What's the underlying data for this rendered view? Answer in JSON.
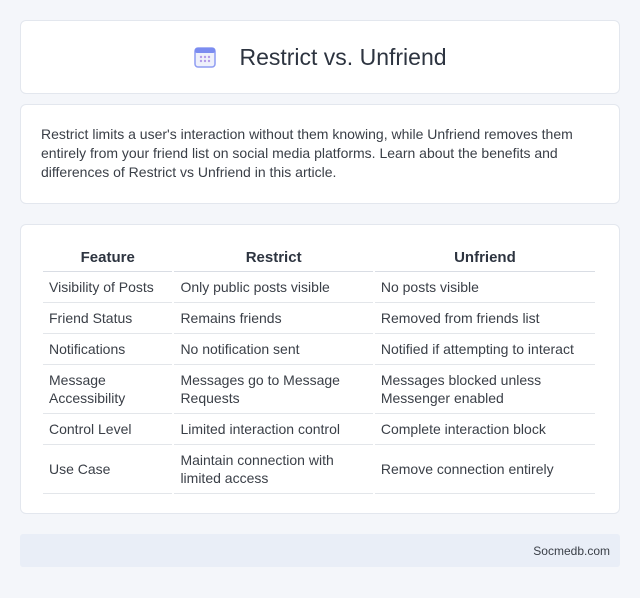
{
  "header": {
    "title": "Restrict vs. Unfriend",
    "icon": "calendar-icon",
    "icon_color": "#7b8cf0"
  },
  "intro": {
    "text": "Restrict limits a user's interaction without them knowing, while Unfriend removes them entirely from your friend list on social media platforms. Learn about the benefits and differences of Restrict vs Unfriend in this article."
  },
  "comparison_table": {
    "headers": [
      "Feature",
      "Restrict",
      "Unfriend"
    ],
    "rows": [
      [
        "Visibility of Posts",
        "Only public posts visible",
        "No posts visible"
      ],
      [
        "Friend Status",
        "Remains friends",
        "Removed from friends list"
      ],
      [
        "Notifications",
        "No notification sent",
        "Notified if attempting to interact"
      ],
      [
        "Message Accessibility",
        "Messages go to Message Requests",
        "Messages blocked unless Messenger enabled"
      ],
      [
        "Control Level",
        "Limited interaction control",
        "Complete interaction block"
      ],
      [
        "Use Case",
        "Maintain connection with limited access",
        "Remove connection entirely"
      ]
    ]
  },
  "footer": {
    "site": "Socmedb.com"
  }
}
